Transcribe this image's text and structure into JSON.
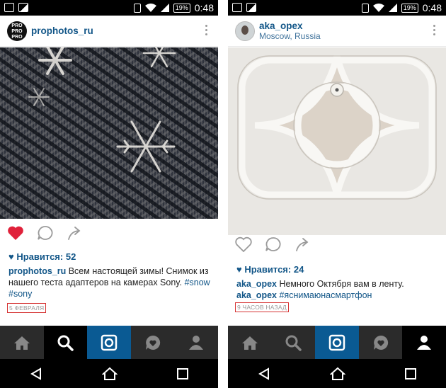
{
  "status_bar": {
    "time": "0:48",
    "battery": "19%"
  },
  "colors": {
    "username": "#125688",
    "location": "#3f729b",
    "tab_bar": "#2b2b2b",
    "tab_active": "#0a5a93",
    "like_red": "#e0213a",
    "timestamp_box": "#d63333"
  },
  "left_post": {
    "username": "prophotos_ru",
    "avatar_text": "PRO PRO PRO",
    "likes": "Нравится: 52",
    "liked": true,
    "caption_user": "prophotos_ru",
    "caption_text": " Всем настоящей зимы! Снимок из нашего теста адаптеров на камерах Sony. ",
    "hashtag_1": "#snow",
    "hashtag_2": "#sony",
    "timestamp": "5 ФЕВРАЛЯ",
    "active_tab": "search"
  },
  "right_post": {
    "username": "aka_opex",
    "location": "Moscow, Russia",
    "likes": "Нравится: 24",
    "liked": false,
    "caption_user_1": "aka_opex",
    "caption_text_1": " Немного Октября вам в ленту.",
    "caption_user_2": "aka_opex",
    "hashtag_1": "#яснимаюнасмартфон",
    "timestamp": "9 ЧАСОВ НАЗАД",
    "active_tab": "profile"
  },
  "tabs": [
    "home-icon",
    "search-icon",
    "camera-icon",
    "activity-icon",
    "profile-icon"
  ]
}
